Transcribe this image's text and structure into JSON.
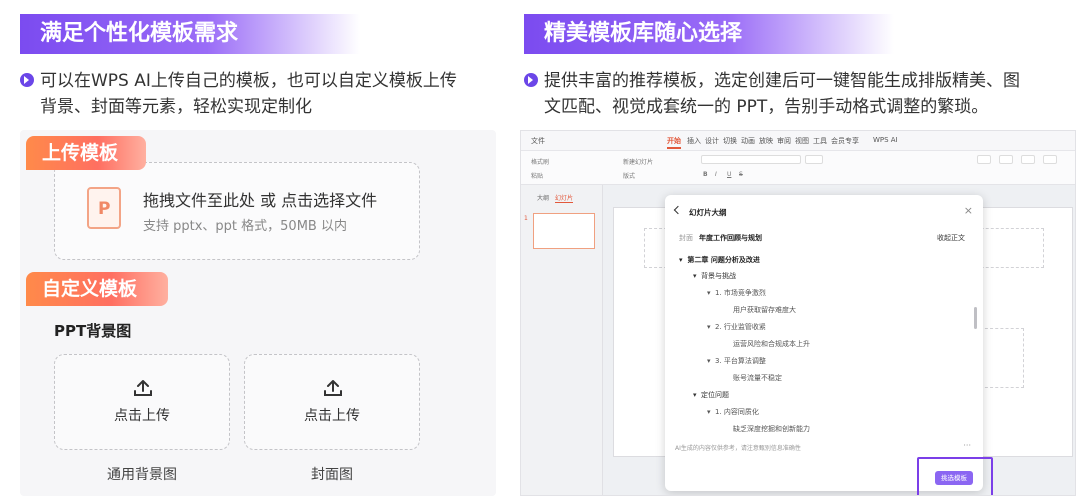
{
  "left": {
    "banner": "满足个性化模板需求",
    "bullet": "可以在WPS AI上传自己的模板，也可以自定义模板上传背景、封面等元素，轻松实现定制化",
    "upload_tab": "上传模板",
    "dropzone": {
      "title": "拖拽文件至此处 或 点击选择文件",
      "subtitle": "支持 pptx、ppt 格式，50MB 以内",
      "file_icon_letter": "P"
    },
    "custom_tab": "自定义模板",
    "ppt_bg_label": "PPT背景图",
    "upload_boxes": [
      {
        "label": "点击上传",
        "caption": "通用背景图"
      },
      {
        "label": "点击上传",
        "caption": "封面图"
      }
    ]
  },
  "right": {
    "banner": "精美模板库随心选择",
    "bullet": "提供丰富的推荐模板，选定创建后可一键智能生成排版精美、图文匹配、视觉成套统一的 PPT，告别手动格式调整的繁琐。",
    "app": {
      "menu": [
        "文件",
        "开始",
        "插入",
        "设计",
        "切换",
        "动画",
        "放映",
        "审阅",
        "视图",
        "工具",
        "会员专享",
        "WPS AI"
      ],
      "active_menu": "开始",
      "toolbar": [
        "格式刷",
        "粘贴",
        "新建幻灯片",
        "版式",
        "B",
        "I",
        "U",
        "S"
      ],
      "pane_tabs": [
        "大纲",
        "幻灯片"
      ],
      "active_pane_tab": "幻灯片",
      "slide_number": "1",
      "dialog": {
        "title": "幻灯片大纲",
        "close": "×",
        "cover_label": "封面",
        "cover_value": "年度工作回顾与规划",
        "collapse": "收起正文",
        "outline": [
          {
            "level": 0,
            "text": "第二章  问题分析及改进"
          },
          {
            "level": 1,
            "text": "背景与挑战"
          },
          {
            "level": 2,
            "text": "1.  市场竞争激烈"
          },
          {
            "level": 3,
            "text": "用户获取留存难度大"
          },
          {
            "level": 2,
            "text": "2.  行业监管收紧"
          },
          {
            "level": 3,
            "text": "运营风险和合规成本上升"
          },
          {
            "level": 2,
            "text": "3.  平台算法调整"
          },
          {
            "level": 3,
            "text": "账号流量不稳定"
          },
          {
            "level": 1,
            "text": "定位问题"
          },
          {
            "level": 2,
            "text": "1.  内容同质化"
          },
          {
            "level": 3,
            "text": "缺乏深度挖掘和创新能力"
          }
        ],
        "footnote": "AI生成的内容仅供参考，请注意甄别信息准确性",
        "more": "···",
        "select_button": "挑选模板"
      }
    }
  }
}
